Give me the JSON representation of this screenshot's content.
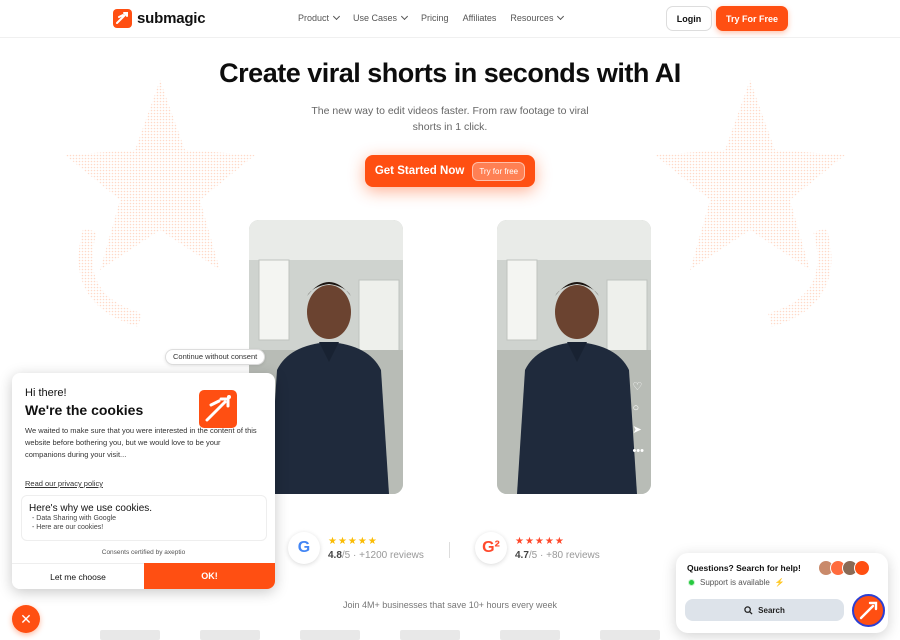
{
  "brand": {
    "name": "submagic",
    "accent": "#ff4f12"
  },
  "nav": {
    "items": [
      {
        "label": "Product",
        "dropdown": true
      },
      {
        "label": "Use Cases",
        "dropdown": true
      },
      {
        "label": "Pricing",
        "dropdown": false
      },
      {
        "label": "Affiliates",
        "dropdown": false
      },
      {
        "label": "Resources",
        "dropdown": true
      }
    ],
    "login": "Login",
    "try_free": "Try For Free"
  },
  "hero": {
    "title": "Create viral shorts in seconds with AI",
    "subtitle": "The new way to edit videos faster. From raw footage to viral shorts in 1 click.",
    "cta_label": "Get Started Now",
    "cta_pill": "Try for free"
  },
  "video_right": {
    "icons": [
      "heart-icon",
      "comment-icon",
      "share-icon",
      "more-icon"
    ]
  },
  "reviews": {
    "google": {
      "stars": "★★★★★",
      "score": "4.8",
      "scale": "/5",
      "count": "+1200 reviews"
    },
    "g2": {
      "stars": "★★★★★",
      "score": "4.7",
      "scale": "/5",
      "count": "+80 reviews"
    },
    "join": "Join 4M+ businesses that save 10+ hours every week"
  },
  "cookie": {
    "continue_without": "Continue without consent",
    "hi": "Hi there!",
    "title": "We're the cookies",
    "body": "We waited to make sure that you were interested in the content of this website before bothering you, but we would love to be your companions during your visit...",
    "privacy_link": "Read our privacy policy",
    "box_title": "Here's why we use cookies.",
    "box_items": [
      "- Data Sharing with Google",
      "- Here are our cookies!"
    ],
    "certified": "Consents certified by",
    "certified_brand": "axeptio",
    "choose": "Let me choose",
    "ok": "OK!"
  },
  "help": {
    "title": "Questions? Search for help!",
    "status": "Support is available",
    "search": "Search"
  }
}
